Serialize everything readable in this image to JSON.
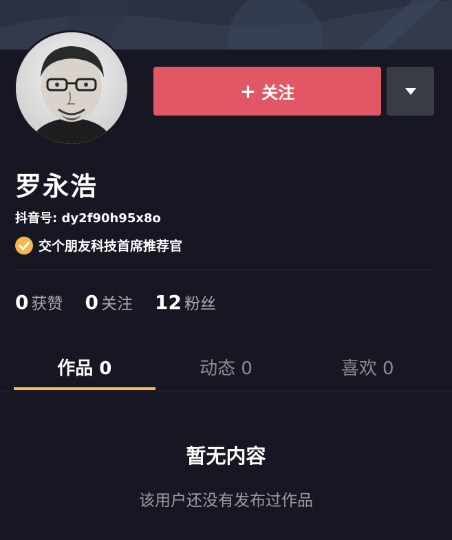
{
  "profile": {
    "name": "罗永浩",
    "douyin_id": "抖音号: dy2f90h95x8o",
    "verified_title": "交个朋友科技首席推荐官"
  },
  "actions": {
    "follow_plus": "+",
    "follow_label": "关注"
  },
  "stats": [
    {
      "value": "0",
      "label": "获赞"
    },
    {
      "value": "0",
      "label": "关注"
    },
    {
      "value": "12",
      "label": "粉丝"
    }
  ],
  "tabs": [
    {
      "label": "作品 0",
      "active": true
    },
    {
      "label": "动态 0",
      "active": false
    },
    {
      "label": "喜欢 0",
      "active": false
    }
  ],
  "empty": {
    "title": "暂无内容",
    "subtitle": "该用户还没有发布过作品"
  },
  "colors": {
    "background": "#161722",
    "follow_button": "#e25765",
    "accent_underline": "#f7c24a",
    "verified_badge": "#f2b84b"
  },
  "icons": {
    "more": "caret-down-icon",
    "verified": "verified-check-icon"
  }
}
